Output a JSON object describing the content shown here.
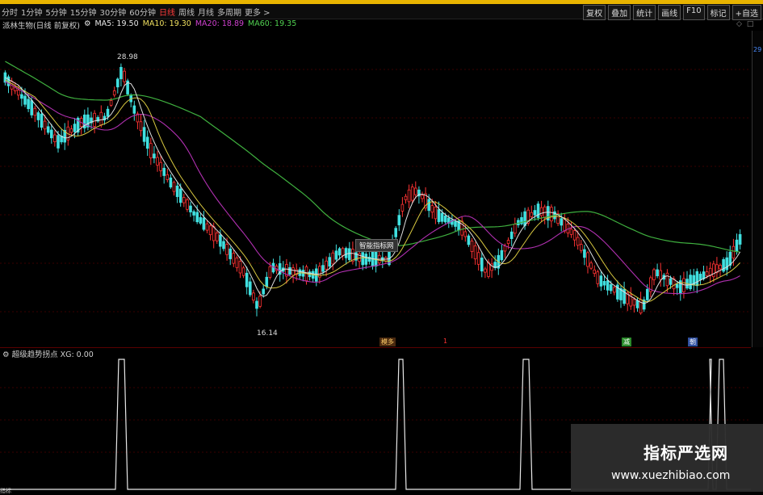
{
  "toolbar": {
    "periods": [
      {
        "label": "分时",
        "active": false
      },
      {
        "label": "1分钟",
        "active": false
      },
      {
        "label": "5分钟",
        "active": false
      },
      {
        "label": "15分钟",
        "active": false
      },
      {
        "label": "30分钟",
        "active": false
      },
      {
        "label": "60分钟",
        "active": false
      },
      {
        "label": "日线",
        "active": true
      },
      {
        "label": "周线",
        "active": false
      },
      {
        "label": "月线",
        "active": false
      },
      {
        "label": "多周期",
        "active": false
      },
      {
        "label": "更多 >",
        "active": false
      }
    ],
    "actions": [
      "复权",
      "叠加",
      "统计",
      "画线",
      "F10",
      "标记",
      "+自选"
    ]
  },
  "info": {
    "stock_name": "派林生物(日线 前复权)",
    "ma5": "MA5: 19.50",
    "ma10": "MA10: 19.30",
    "ma20": "MA20: 18.89",
    "ma60": "MA60: 19.35"
  },
  "annotations": {
    "high": "28.98",
    "low": "16.14",
    "tooltip": "智能指标网"
  },
  "signals": {
    "s1": "模多",
    "s2": "1",
    "s3": "减",
    "s4": "朝"
  },
  "axis": {
    "top_label": "29"
  },
  "indicator": {
    "title": "超级趋势拐点 XG: 0.00"
  },
  "watermark": {
    "cn": "指标严选网",
    "url": "www.xuezhibiao.com"
  },
  "bottom_tab": "指标"
}
